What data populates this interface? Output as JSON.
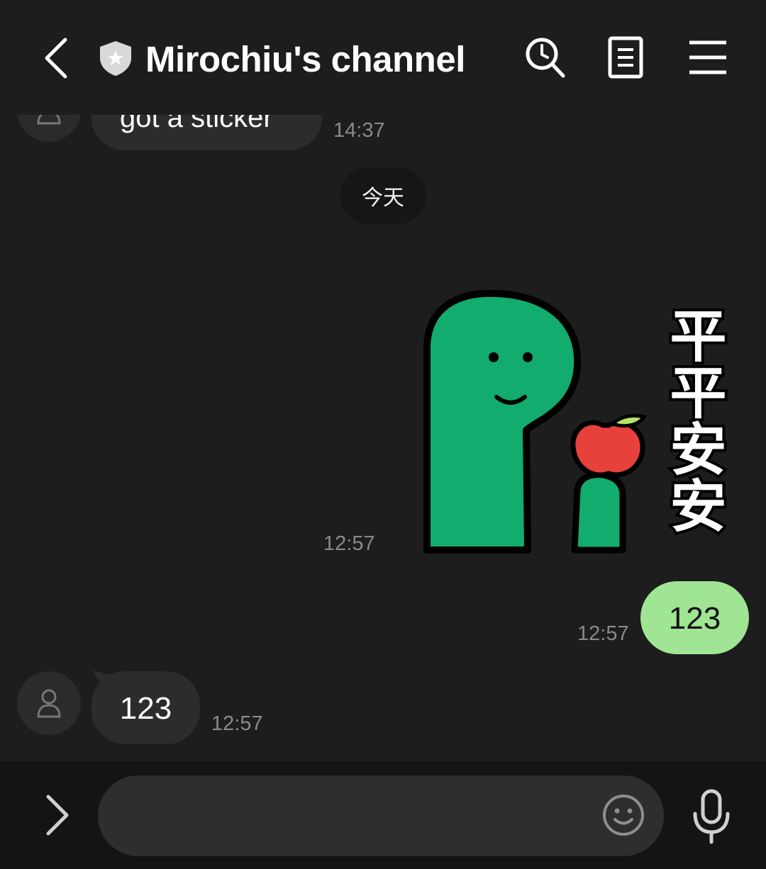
{
  "header": {
    "title": "Mirochiu's channel",
    "icons": [
      "back-icon",
      "shield-icon",
      "search-icon",
      "notes-icon",
      "menu-icon"
    ]
  },
  "messages": [
    {
      "direction": "in",
      "text": "got a sticker",
      "time": "14:37"
    },
    {
      "direction": "out",
      "type": "sticker",
      "sticker_text": "平平安安",
      "time": "12:57"
    },
    {
      "direction": "out",
      "text": "123",
      "time": "12:57"
    },
    {
      "direction": "in",
      "text": "123",
      "time": "12:57"
    }
  ],
  "date_divider": "今天",
  "composer": {
    "placeholder": "",
    "icons": [
      "expand-icon",
      "emoji-icon",
      "microphone-icon"
    ]
  },
  "colors": {
    "background": "#1d1d1d",
    "incoming_bubble": "#2c2c2c",
    "outgoing_bubble": "#9fe594",
    "sticker_green": "#12ad6e",
    "apple_red": "#e8403b"
  }
}
